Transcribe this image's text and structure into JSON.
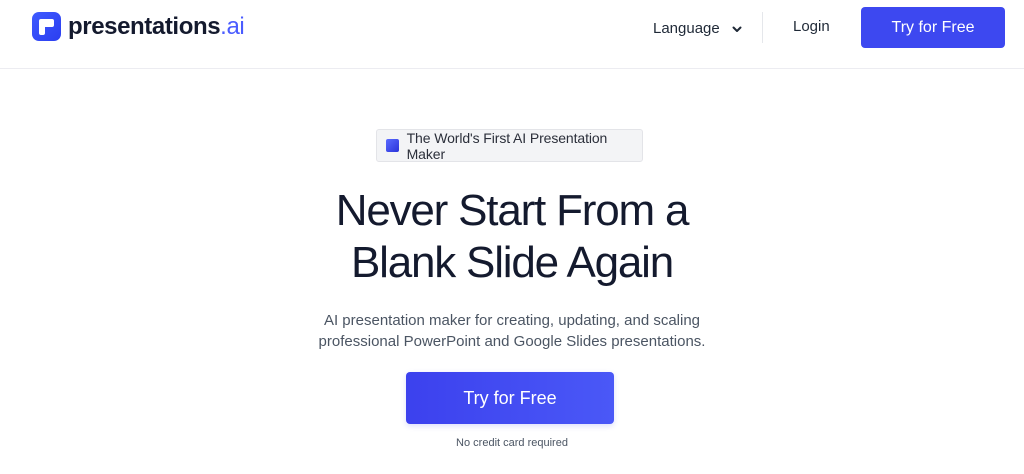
{
  "header": {
    "logo": {
      "name": "presentations",
      "suffix": ".ai",
      "icon": "presentations-logo-icon"
    },
    "language_label": "Language",
    "language_icon": "chevron-down-icon",
    "login_label": "Login",
    "try_label": "Try for Free"
  },
  "hero": {
    "badge": {
      "text": "The World's First AI Presentation Maker",
      "icon": "square-icon"
    },
    "headline_lines": [
      "Never Start From a",
      "Blank Slide Again"
    ],
    "subtitle_lines": [
      "AI presentation maker for creating, updating, and scaling",
      "professional PowerPoint and Google Slides presentations."
    ],
    "cta_label": "Try for Free",
    "note": "No credit card required"
  },
  "colors": {
    "accent": "#3d48f0",
    "logo_ai": "#4a5cff",
    "text_dark": "#141a2e",
    "text_muted": "#4b5563"
  }
}
